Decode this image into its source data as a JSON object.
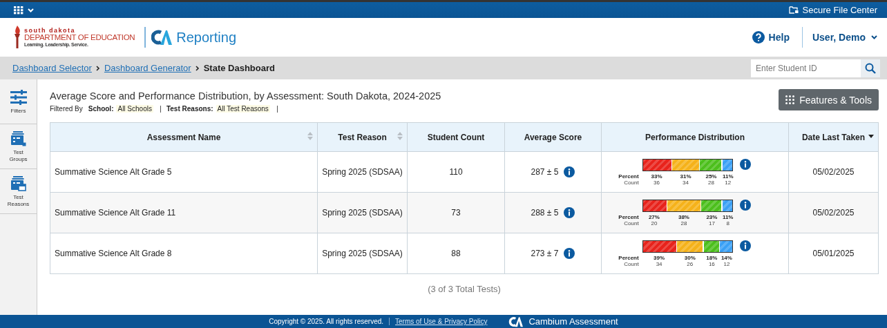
{
  "top_bar": {
    "secure_file_center": "Secure File Center"
  },
  "header": {
    "logo": {
      "line_1": "south dakota",
      "line_2": "DEPARTMENT OF EDUCATION",
      "line_3": "Learning. Leadership. Service."
    },
    "app_name": "Reporting",
    "help": "Help",
    "user": "User, Demo"
  },
  "breadcrumb": {
    "links": [
      "Dashboard Selector",
      "Dashboard Generator"
    ],
    "current": "State Dashboard"
  },
  "student_search": {
    "placeholder": "Enter Student ID"
  },
  "sidebar": {
    "items": [
      {
        "label": "Filters",
        "kind": "filters"
      },
      {
        "label": "Test Groups",
        "kind": "groups"
      },
      {
        "label": "Test Reasons",
        "kind": "reasons"
      }
    ]
  },
  "report": {
    "title": "Average Score and Performance Distribution, by Assessment: South Dakota, 2024-2025",
    "filtered_by": "Filtered By",
    "filters": [
      {
        "name": "School:",
        "value": "All Schools"
      },
      {
        "name": "Test Reasons:",
        "value": "All Test Reasons"
      }
    ],
    "features_button": "Features & Tools"
  },
  "table": {
    "columns": [
      {
        "label": "Assessment Name",
        "sortable": true,
        "sorted": false
      },
      {
        "label": "Test Reason",
        "sortable": true,
        "sorted": false
      },
      {
        "label": "Student Count"
      },
      {
        "label": "Average Score"
      },
      {
        "label": "Performance Distribution"
      },
      {
        "label": "Date Last Taken",
        "sortable": true,
        "sorted": true
      }
    ],
    "rows": [
      {
        "assessment": "Summative Science Alt Grade 5",
        "reason": "Spring 2025 (SDSAA)",
        "count": "110",
        "score": "287 ± 5",
        "distribution": {
          "percent_label": "Percent",
          "count_label": "Count",
          "segments": [
            {
              "percent": "33%",
              "count": "36",
              "color": "#e8231c"
            },
            {
              "percent": "31%",
              "count": "34",
              "color": "#f5b21a"
            },
            {
              "percent": "25%",
              "count": "28",
              "color": "#4cbf1c"
            },
            {
              "percent": "11%",
              "count": "12",
              "color": "#3aa0f5"
            }
          ]
        },
        "date": "05/02/2025"
      },
      {
        "assessment": "Summative Science Alt Grade 11",
        "reason": "Spring 2025 (SDSAA)",
        "count": "73",
        "score": "288 ± 5",
        "distribution": {
          "percent_label": "Percent",
          "count_label": "Count",
          "segments": [
            {
              "percent": "27%",
              "count": "20",
              "color": "#e8231c"
            },
            {
              "percent": "38%",
              "count": "28",
              "color": "#f5b21a"
            },
            {
              "percent": "23%",
              "count": "17",
              "color": "#4cbf1c"
            },
            {
              "percent": "11%",
              "count": "8",
              "color": "#3aa0f5"
            }
          ]
        },
        "date": "05/02/2025"
      },
      {
        "assessment": "Summative Science Alt Grade 8",
        "reason": "Spring 2025 (SDSAA)",
        "count": "88",
        "score": "273 ± 7",
        "distribution": {
          "percent_label": "Percent",
          "count_label": "Count",
          "segments": [
            {
              "percent": "39%",
              "count": "34",
              "color": "#e8231c"
            },
            {
              "percent": "30%",
              "count": "26",
              "color": "#f5b21a"
            },
            {
              "percent": "18%",
              "count": "16",
              "color": "#4cbf1c"
            },
            {
              "percent": "14%",
              "count": "12",
              "color": "#3aa0f5"
            }
          ]
        },
        "date": "05/01/2025"
      }
    ],
    "total": "(3 of 3 Total Tests)"
  },
  "footer": {
    "copyright": "Copyright © 2025. All rights reserved.",
    "terms_link": "Terms of Use & Privacy Policy",
    "brand": "Cambium Assessment"
  }
}
